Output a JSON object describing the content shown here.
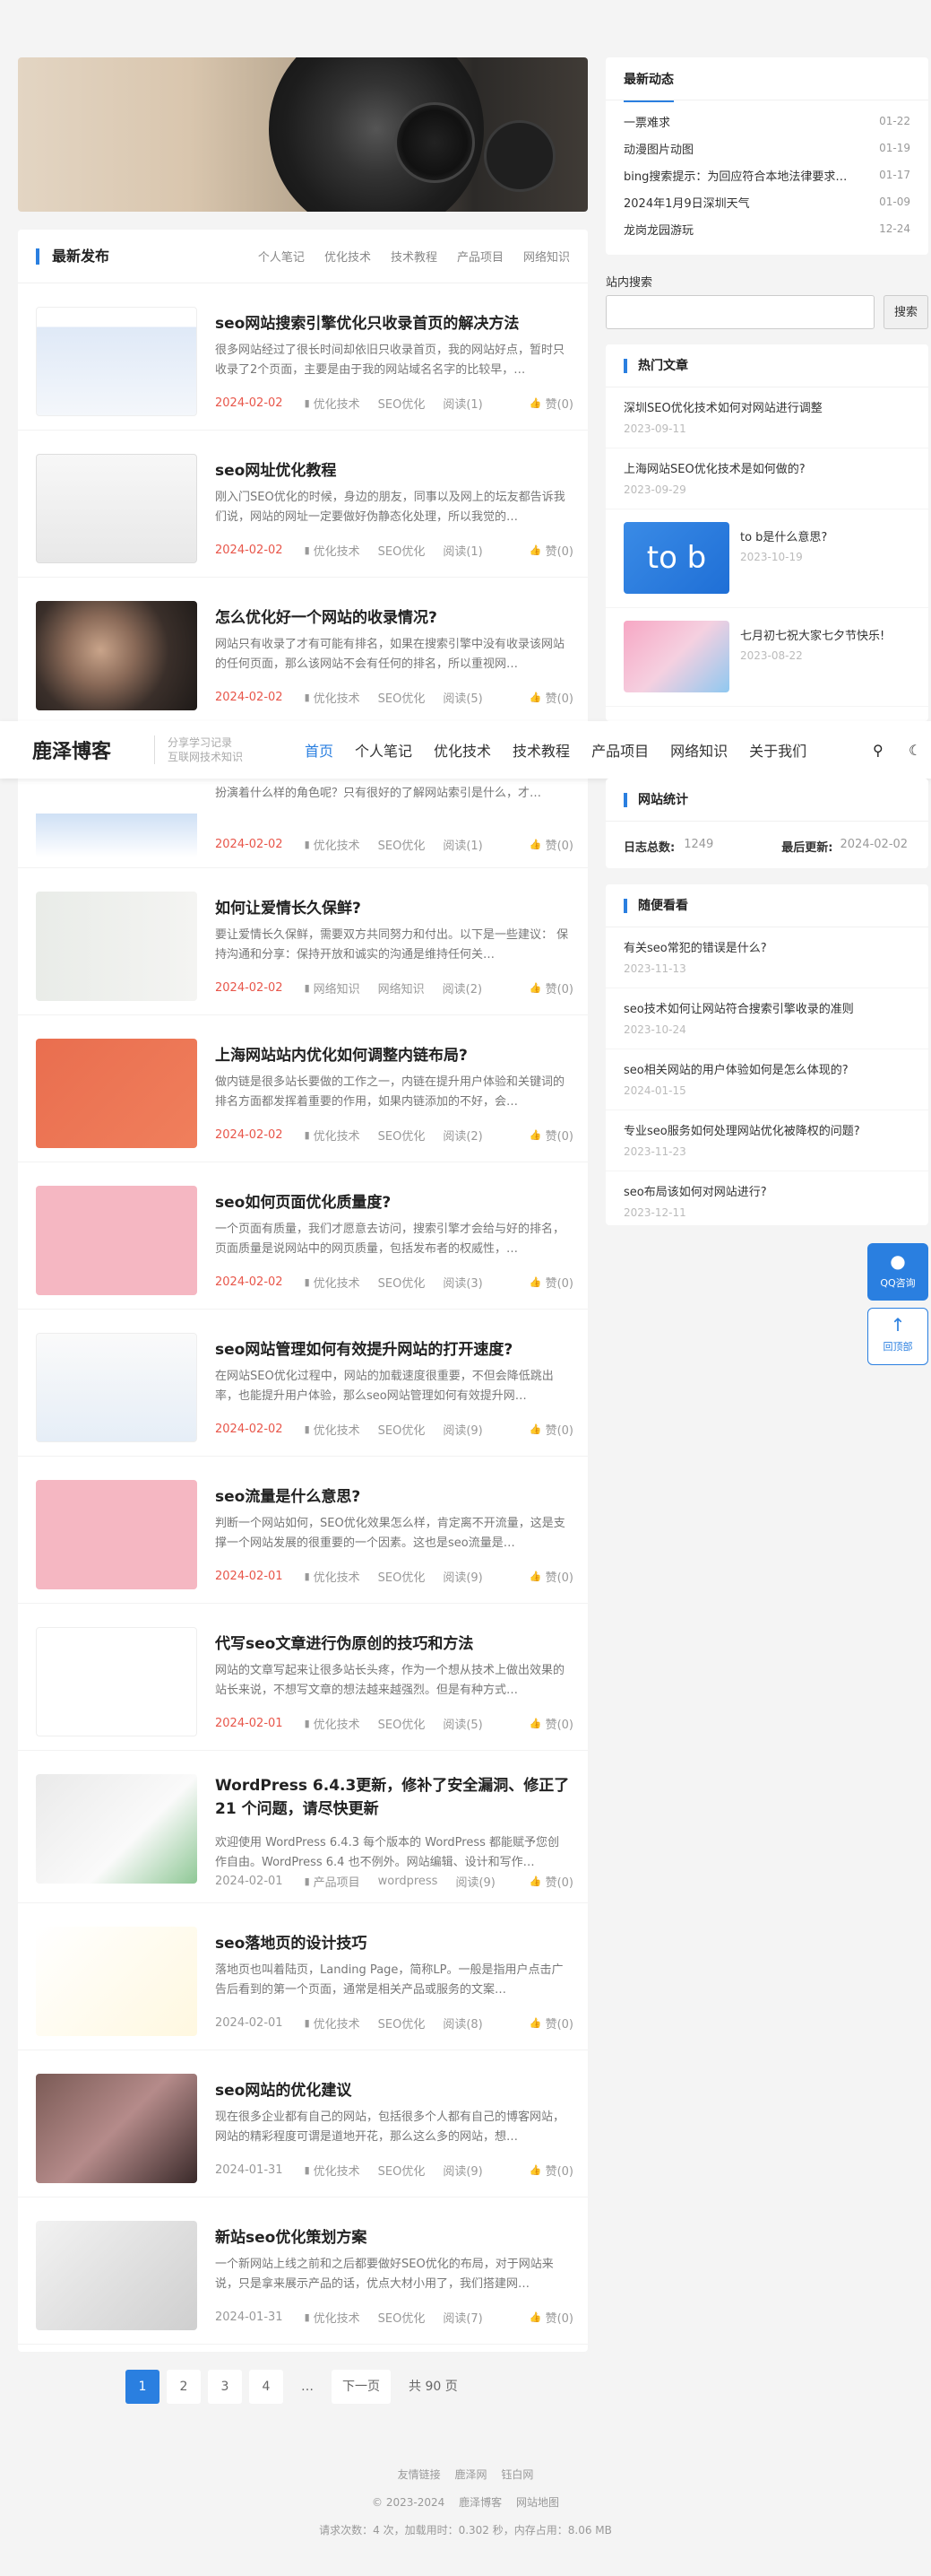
{
  "header": {
    "logo": "鹿泽博客",
    "slogan_1": "分享学习记录",
    "slogan_2": "互联网技术知识",
    "nav": [
      "首页",
      "个人笔记",
      "优化技术",
      "技术教程",
      "产品项目",
      "网络知识",
      "关于我们"
    ],
    "search_icon": "search-icon",
    "theme_icon": "moon-icon"
  },
  "latest": {
    "title": "最新发布",
    "tabs": [
      "个人笔记",
      "优化技术",
      "技术教程",
      "产品项目",
      "网络知识"
    ]
  },
  "posts": [
    {
      "title": "seo网站搜索引擎优化只收录首页的解决方法",
      "desc": "很多网站经过了很长时间却依旧只收录首页，我的网站好点，暂时只收录了2个页面，主要是由于我的网站域名名字的比较早，…",
      "date": "2024-02-02",
      "cat": "优化技术",
      "tag": "SEO优化",
      "reads": "阅读(1)",
      "likes": "赞(0)"
    },
    {
      "title": "seo网址优化教程",
      "desc": "刚入门SEO优化的时候，身边的朋友，同事以及网上的坛友都告诉我们说，网站的网址一定要做好伪静态化处理，所以我觉的…",
      "date": "2024-02-02",
      "cat": "优化技术",
      "tag": "SEO优化",
      "reads": "阅读(1)",
      "likes": "赞(0)"
    },
    {
      "title": "怎么优化好一个网站的收录情况?",
      "desc": "网站只有收录了才有可能有排名，如果在搜索引擎中没有收录该网站的任何页面，那么该网站不会有任何的排名，所以重视网…",
      "date": "2024-02-02",
      "cat": "优化技术",
      "tag": "SEO优化",
      "reads": "阅读(5)",
      "likes": "赞(0)"
    },
    {
      "title": "",
      "desc": "扮演着什么样的角色呢？只有很好的了解网站索引是什么，才…",
      "date": "2024-02-02",
      "cat": "优化技术",
      "tag": "SEO优化",
      "reads": "阅读(1)",
      "likes": "赞(0)"
    },
    {
      "title": "如何让爱情长久保鲜?",
      "desc": "要让爱情长久保鲜，需要双方共同努力和付出。以下是一些建议： 保持沟通和分享：保持开放和诚实的沟通是维持任何关…",
      "date": "2024-02-02",
      "cat": "网络知识",
      "tag": "网络知识",
      "reads": "阅读(2)",
      "likes": "赞(0)"
    },
    {
      "title": "上海网站站内优化如何调整内链布局?",
      "desc": "做内链是很多站长要做的工作之一，内链在提升用户体验和关键词的排名方面都发挥着重要的作用，如果内链添加的不好，会…",
      "date": "2024-02-02",
      "cat": "优化技术",
      "tag": "SEO优化",
      "reads": "阅读(2)",
      "likes": "赞(0)"
    },
    {
      "title": "seo如何页面优化质量度?",
      "desc": "一个页面有质量，我们才愿意去访问，搜索引擎才会给与好的排名，页面质量是说网站中的网页质量，包括发布者的权威性，…",
      "date": "2024-02-02",
      "cat": "优化技术",
      "tag": "SEO优化",
      "reads": "阅读(3)",
      "likes": "赞(0)"
    },
    {
      "title": "seo网站管理如何有效提升网站的打开速度?",
      "desc": "在网站SEO优化过程中，网站的加载速度很重要，不但会降低跳出率，也能提升用户体验，那么seo网站管理如何有效提升网…",
      "date": "2024-02-02",
      "cat": "优化技术",
      "tag": "SEO优化",
      "reads": "阅读(9)",
      "likes": "赞(0)"
    },
    {
      "title": "seo流量是什么意思?",
      "desc": "判断一个网站如何，SEO优化效果怎么样，肯定离不开流量，这是支撑一个网站发展的很重要的一个因素。这也是seo流量是…",
      "date": "2024-02-01",
      "cat": "优化技术",
      "tag": "SEO优化",
      "reads": "阅读(9)",
      "likes": "赞(0)"
    },
    {
      "title": "代写seo文章进行伪原创的技巧和方法",
      "desc": "网站的文章写起来让很多站长头疼，作为一个想从技术上做出效果的站长来说，不想写文章的想法越来越强烈。但是有种方式…",
      "date": "2024-02-01",
      "cat": "优化技术",
      "tag": "SEO优化",
      "reads": "阅读(5)",
      "likes": "赞(0)"
    },
    {
      "title": "WordPress 6.4.3更新，修补了安全漏洞、修正了 21 个问题，请尽快更新",
      "desc": "欢迎使用 WordPress 6.4.3 每个版本的 WordPress 都能赋予您创作自由。WordPress 6.4 也不例外。网站编辑、设计和写作…",
      "date": "2024-02-01",
      "cat": "产品项目",
      "tag": "wordpress",
      "reads": "阅读(9)",
      "likes": "赞(0)"
    },
    {
      "title": "seo落地页的设计技巧",
      "desc": "落地页也叫着陆页，Landing Page，简称LP。一般是指用户点击广告后看到的第一个页面，通常是相关产品或服务的文案…",
      "date": "2024-02-01",
      "cat": "优化技术",
      "tag": "SEO优化",
      "reads": "阅读(8)",
      "likes": "赞(0)"
    },
    {
      "title": "seo网站的优化建议",
      "desc": "现在很多企业都有自己的网站，包括很多个人都有自己的博客网站，网站的精彩程度可谓是道地开花，那么这么多的网站，想…",
      "date": "2024-01-31",
      "cat": "优化技术",
      "tag": "SEO优化",
      "reads": "阅读(9)",
      "likes": "赞(0)"
    },
    {
      "title": "新站seo优化策划方案",
      "desc": "一个新网站上线之前和之后都要做好SEO优化的布局，对于网站来说，只是拿来展示产品的话，优点大材小用了，我们搭建网…",
      "date": "2024-01-31",
      "cat": "优化技术",
      "tag": "SEO优化",
      "reads": "阅读(7)",
      "likes": "赞(0)"
    }
  ],
  "pager": {
    "pages": [
      "1",
      "2",
      "3",
      "4"
    ],
    "ellipsis": "…",
    "next": "下一页",
    "total": "共 90 页"
  },
  "sidebar": {
    "news_title": "最新动态",
    "news": [
      {
        "t": "一票难求",
        "d": "01-22"
      },
      {
        "t": "动漫图片动图",
        "d": "01-19"
      },
      {
        "t": "bing搜索提示：为回应符合本地法律要求…",
        "d": "01-17"
      },
      {
        "t": "2024年1月9日深圳天气",
        "d": "01-09"
      },
      {
        "t": "龙岗龙园游玩",
        "d": "12-24"
      }
    ],
    "search_label": "站内搜索",
    "search_btn": "搜索",
    "hot_title": "热门文章",
    "hot": [
      {
        "t": "深圳SEO优化技术如何对网站进行调整",
        "d": "2023-09-11"
      },
      {
        "t": "上海网站SEO优化技术是如何做的?",
        "d": "2023-09-29"
      },
      {
        "t": "to b是什么意思?",
        "d": "2023-10-19",
        "img": "to b"
      },
      {
        "t": "七月初七祝大家七夕节快乐!",
        "d": "2023-08-22"
      }
    ],
    "stats_title": "网站统计",
    "stats_total_label": "日志总数:",
    "stats_total": "1249",
    "stats_update_label": "最后更新:",
    "stats_update": "2024-02-02",
    "random_title": "随便看看",
    "random": [
      {
        "t": "有关seo常犯的错误是什么?",
        "d": "2023-11-13"
      },
      {
        "t": "seo技术如何让网站符合搜索引擎收录的准则",
        "d": "2023-10-24"
      },
      {
        "t": "seo相关网站的用户体验如何是怎么体现的?",
        "d": "2024-01-15"
      },
      {
        "t": "专业seo服务如何处理网站优化被降权的问题?",
        "d": "2023-11-23"
      },
      {
        "t": "seo布局该如何对网站进行?",
        "d": "2023-12-11"
      }
    ]
  },
  "float": {
    "qq": "QQ咨询",
    "top": "回顶部"
  },
  "footer": {
    "links": [
      "友情链接",
      "鹿泽网",
      "钰白网"
    ],
    "copy": "© 2023-2024",
    "copy_name": "鹿泽博客",
    "sitemap": "网站地图",
    "stats": "请求次数：4 次，加载用时：0.302 秒，内存占用：8.06 MB"
  }
}
